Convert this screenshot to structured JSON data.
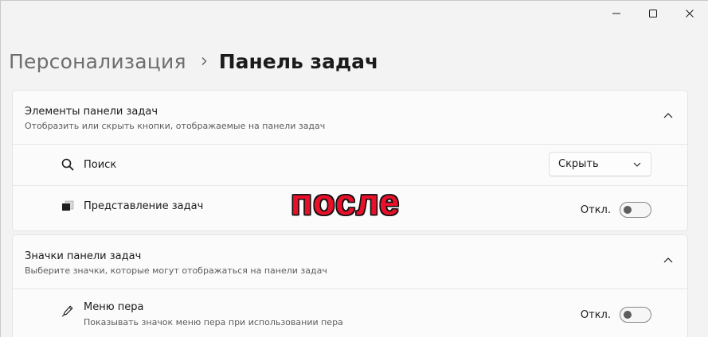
{
  "window": {
    "minimize_icon": "minimize-icon",
    "maximize_icon": "maximize-icon",
    "close_icon": "close-icon"
  },
  "breadcrumb": {
    "parent": "Персонализация",
    "current": "Панель задач"
  },
  "sections": [
    {
      "title": "Элементы панели задач",
      "subtitle": "Отобразить или скрыть кнопки, отображаемые на панели задач",
      "expanded": true,
      "items": [
        {
          "label": "Поиск",
          "icon": "search-icon",
          "control": "dropdown",
          "value": "Скрыть"
        },
        {
          "label": "Представление задач",
          "icon": "task-view-icon",
          "control": "toggle",
          "state_label": "Откл.",
          "on": false
        }
      ]
    },
    {
      "title": "Значки панели задач",
      "subtitle": "Выберите значки, которые могут отображаться на панели задач",
      "expanded": true,
      "items": [
        {
          "label": "Меню пера",
          "description": "Показывать значок меню пера при использовании пера",
          "icon": "pen-icon",
          "control": "toggle",
          "state_label": "Откл.",
          "on": false
        }
      ]
    }
  ],
  "overlay": {
    "text": "после",
    "color": "#e8102a"
  },
  "colors": {
    "background": "#f3f3f3",
    "card": "#fbfbfb",
    "toggle_off_knob": "#5d5d5d"
  }
}
